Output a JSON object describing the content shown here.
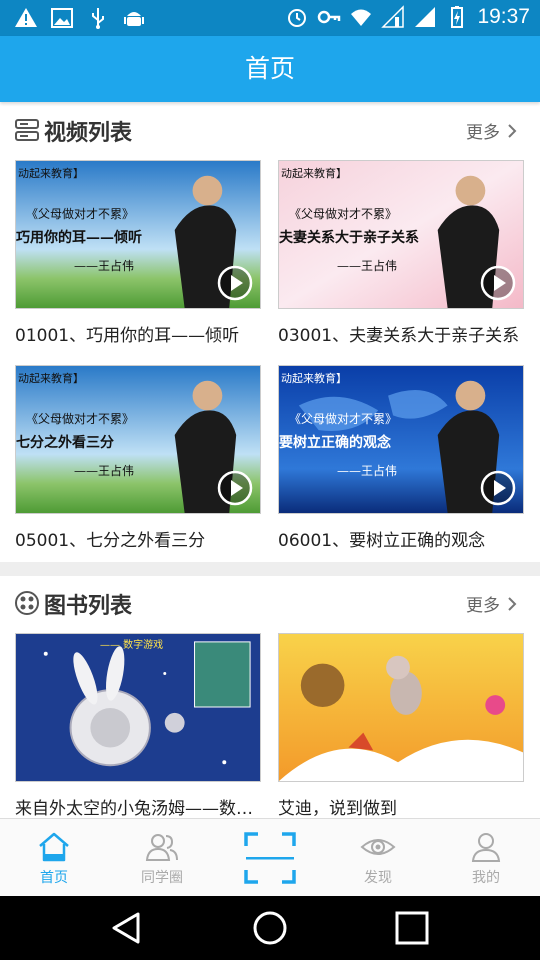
{
  "status_bar": {
    "time": "19:37",
    "icons_left": [
      "warning-icon",
      "image-icon",
      "usb-icon",
      "android-icon"
    ],
    "icons_right": [
      "alarm-icon",
      "key-icon",
      "wifi-icon",
      "signal-icon",
      "signal-icon",
      "battery-icon"
    ]
  },
  "app_bar": {
    "title": "首页"
  },
  "video_section": {
    "title": "视频列表",
    "more_label": "更多",
    "items": [
      {
        "caption": "01001、巧用你的耳——倾听",
        "thumb_title": "《父母做对才不累》",
        "thumb_subtitle": "巧用你的耳——倾听",
        "thumb_author": "——王占伟",
        "thumb_brand": "动起来教育】"
      },
      {
        "caption": "03001、夫妻关系大于亲子关系",
        "thumb_title": "《父母做对才不累》",
        "thumb_subtitle": "夫妻关系大于亲子关系",
        "thumb_author": "——王占伟",
        "thumb_brand": "动起来教育】"
      },
      {
        "caption": "05001、七分之外看三分",
        "thumb_title": "《父母做对才不累》",
        "thumb_subtitle": "七分之外看三分",
        "thumb_author": "——王占伟",
        "thumb_brand": "动起来教育】"
      },
      {
        "caption": "06001、要树立正确的观念",
        "thumb_title": "《父母做对才不累》",
        "thumb_subtitle": "要树立正确的观念",
        "thumb_author": "——王占伟",
        "thumb_brand": "动起来教育】"
      }
    ]
  },
  "book_section": {
    "title": "图书列表",
    "more_label": "更多",
    "items": [
      {
        "caption": "来自外太空的小兔汤姆——数字游戏",
        "cover_text": "—— 数字游戏"
      },
      {
        "caption": "艾迪，说到做到",
        "cover_text": ""
      }
    ]
  },
  "bottom_nav": {
    "items": [
      {
        "label": "首页",
        "icon": "home-icon",
        "active": true
      },
      {
        "label": "同学圈",
        "icon": "people-icon",
        "active": false
      },
      {
        "label": "",
        "icon": "scan-icon",
        "active": false
      },
      {
        "label": "发现",
        "icon": "eye-icon",
        "active": false
      },
      {
        "label": "我的",
        "icon": "user-icon",
        "active": false
      }
    ]
  },
  "colors": {
    "status_bar": "#0d86c3",
    "app_bar": "#1ea6ec",
    "accent": "#1ea6ec",
    "inactive": "#aaaaaa"
  }
}
